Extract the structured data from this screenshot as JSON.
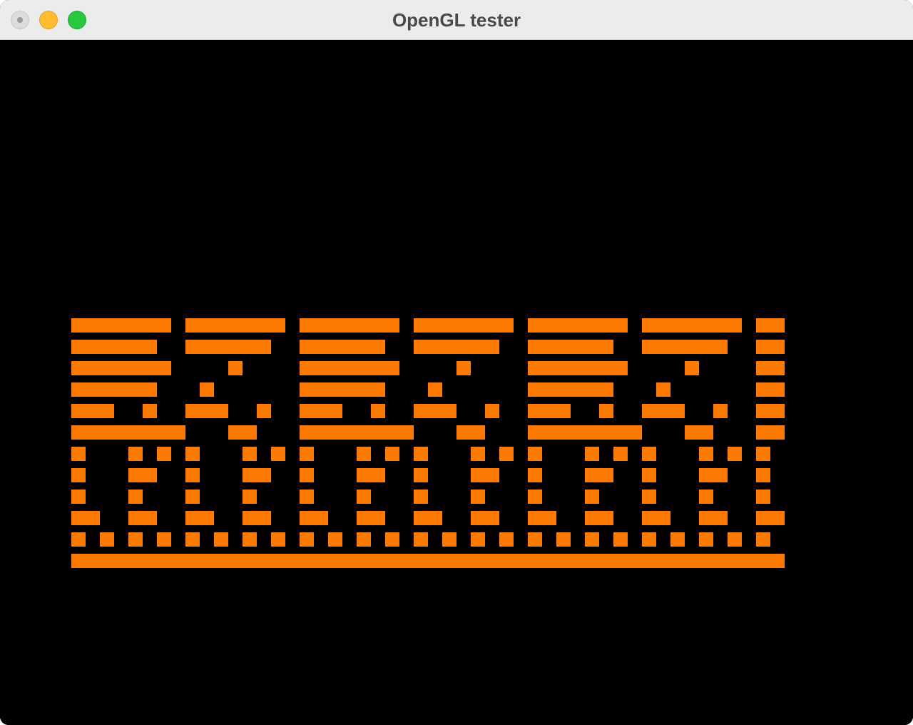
{
  "window": {
    "title": "OpenGL tester"
  },
  "colors": {
    "pattern": "#ff7a00",
    "background": "#000000"
  },
  "icons": {
    "close": "close-button-icon",
    "minimize": "minimize-button-icon",
    "zoom": "zoom-button-icon"
  }
}
